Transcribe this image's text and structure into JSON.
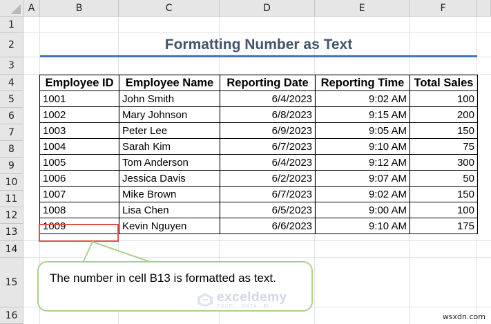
{
  "columns": [
    "A",
    "B",
    "C",
    "D",
    "E",
    "F"
  ],
  "rows": [
    "1",
    "2",
    "3",
    "4",
    "5",
    "6",
    "7",
    "8",
    "9",
    "10",
    "11",
    "12",
    "13",
    "14",
    "15",
    "16"
  ],
  "title": "Formatting Number as Text",
  "table": {
    "headers": [
      "Employee ID",
      "Employee Name",
      "Reporting Date",
      "Reporting Time",
      "Total Sales"
    ],
    "rows": [
      [
        "1001",
        "John Smith",
        "6/4/2023",
        "9:02 AM",
        "100"
      ],
      [
        "1002",
        "Mary Johnson",
        "6/8/2023",
        "9:15 AM",
        "200"
      ],
      [
        "1003",
        "Peter Lee",
        "6/9/2023",
        "9:05 AM",
        "150"
      ],
      [
        "1004",
        "Sarah Kim",
        "6/7/2023",
        "9:10 AM",
        "75"
      ],
      [
        "1005",
        "Tom Anderson",
        "6/4/2023",
        "9:12 AM",
        "300"
      ],
      [
        "1006",
        "Jessica Davis",
        "6/2/2023",
        "9:07 AM",
        "50"
      ],
      [
        "1007",
        "Mike Brown",
        "6/7/2023",
        "9:02 AM",
        "150"
      ],
      [
        "1008",
        "Lisa Chen",
        "6/5/2023",
        "9:00 AM",
        "100"
      ],
      [
        "1009",
        "Kevin Nguyen",
        "6/6/2023",
        "9:10 AM",
        "175"
      ]
    ]
  },
  "callout": {
    "text": "The number in cell B13 is formatted as text."
  },
  "watermark": {
    "name": "exceldemy",
    "tagline": "EXCEL · DATA · BI",
    "icon": "exceldemy-logo-icon"
  },
  "corner_watermark": "wsxdn.com",
  "colors": {
    "title": "#44546a",
    "title_underline": "#4472c4",
    "selection": "#e0504b",
    "callout_border": "#a9d18e"
  }
}
